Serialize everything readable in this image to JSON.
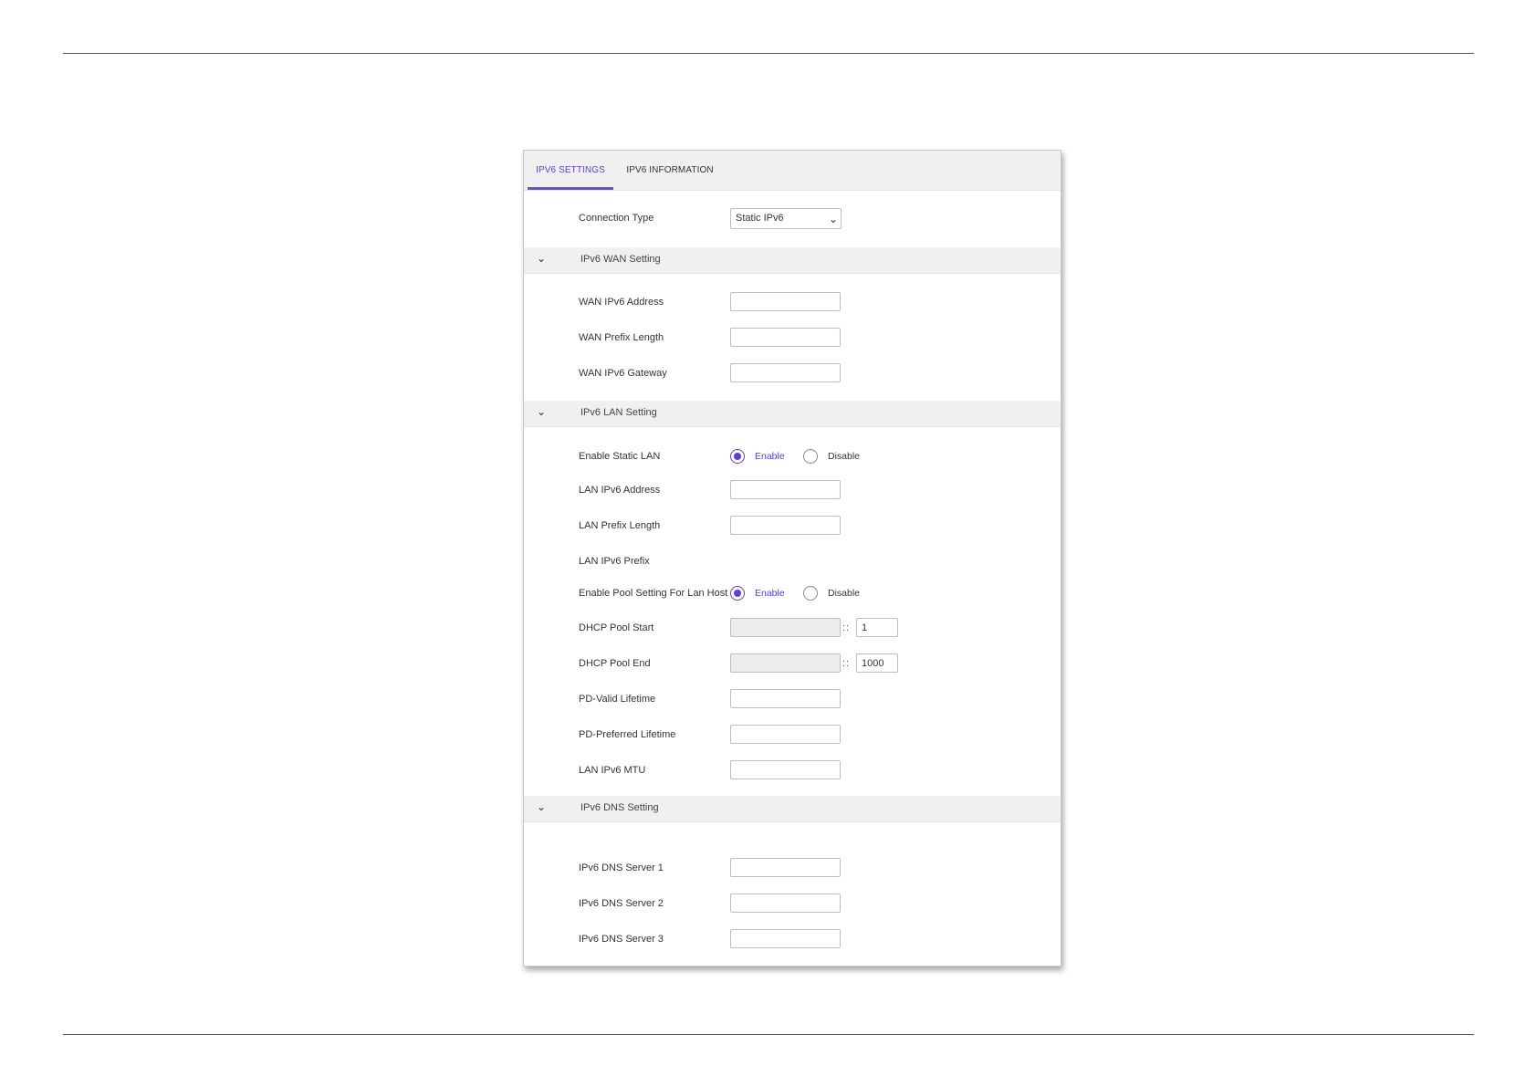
{
  "tabs": [
    {
      "label": "IPV6 SETTINGS",
      "active": true
    },
    {
      "label": "IPV6 INFORMATION",
      "active": false
    }
  ],
  "connection": {
    "label": "Connection Type",
    "value": "Static IPv6"
  },
  "sections": {
    "wan": {
      "title": "IPv6 WAN Setting",
      "fields": {
        "address": {
          "label": "WAN IPv6 Address",
          "value": ""
        },
        "prefix": {
          "label": "WAN Prefix Length",
          "value": ""
        },
        "gateway": {
          "label": "WAN IPv6 Gateway",
          "value": ""
        }
      }
    },
    "lan": {
      "title": "IPv6 LAN Setting",
      "enable_static": {
        "label": "Enable Static LAN",
        "enable": "Enable",
        "disable": "Disable",
        "selected": "Enable"
      },
      "address": {
        "label": "LAN IPv6 Address",
        "value": ""
      },
      "prefix_length": {
        "label": "LAN Prefix Length",
        "value": ""
      },
      "prefix": {
        "label": "LAN IPv6 Prefix"
      },
      "pool_setting": {
        "label": "Enable Pool Setting For Lan Host",
        "enable": "Enable",
        "disable": "Disable",
        "selected": "Enable"
      },
      "pool_start": {
        "label": "DHCP Pool Start",
        "separator": "::",
        "suffix": "1"
      },
      "pool_end": {
        "label": "DHCP Pool End",
        "separator": "::",
        "suffix": "1000"
      },
      "valid_lifetime": {
        "label": "PD-Valid Lifetime",
        "value": ""
      },
      "preferred_lifetime": {
        "label": "PD-Preferred Lifetime",
        "value": ""
      },
      "mtu": {
        "label": "LAN IPv6 MTU",
        "value": ""
      }
    },
    "dns": {
      "title": "IPv6 DNS Setting",
      "server1": {
        "label": "IPv6 DNS Server 1",
        "value": ""
      },
      "server2": {
        "label": "IPv6 DNS Server 2",
        "value": ""
      },
      "server3": {
        "label": "IPv6 DNS Server 3",
        "value": ""
      }
    }
  },
  "icons": {
    "section_toggle": "chevron-down-icon",
    "select_arrow": "chevron-down-icon"
  },
  "colors": {
    "accent": "#5b3fd6",
    "section_bg": "#f0f0f0"
  }
}
